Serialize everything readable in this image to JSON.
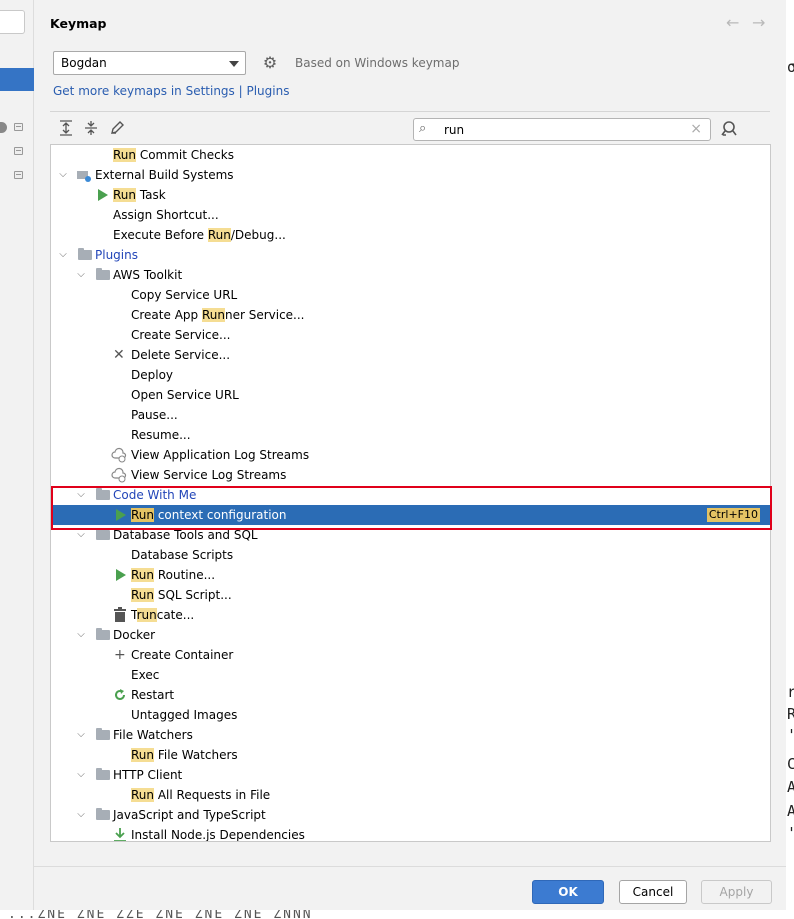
{
  "dialog": {
    "title": "Keymap",
    "nav_back": "←",
    "nav_forward": "→"
  },
  "keymap": {
    "selected": "Bogdan",
    "based_on": "Based on Windows keymap",
    "get_more_link": "Get more keymaps in Settings | Plugins"
  },
  "search": {
    "value": "run",
    "search_icon": "search-with-history-icon",
    "clear_icon": "×"
  },
  "toolbar": {
    "expand_all_icon": "expand-all-icon",
    "collapse_all_icon": "collapse-all-icon",
    "edit_icon": "pencil-icon",
    "find_shortcut_icon": "find-by-shortcut-icon"
  },
  "tree": {
    "rows": [
      {
        "pre": "",
        "hl": "Run",
        "post": " Commit Checks"
      },
      {
        "pre": "External Build Systems",
        "hl": "",
        "post": ""
      },
      {
        "pre": "",
        "hl": "Run",
        "post": " Task"
      },
      {
        "pre": "Assign Shortcut...",
        "hl": "",
        "post": ""
      },
      {
        "pre": "Execute Before ",
        "hl": "Run",
        "post": "/Debug..."
      },
      {
        "pre": "Plugins",
        "hl": "",
        "post": ""
      },
      {
        "pre": "AWS Toolkit",
        "hl": "",
        "post": ""
      },
      {
        "pre": "Copy Service URL",
        "hl": "",
        "post": ""
      },
      {
        "pre": "Create App ",
        "hl": "Run",
        "post": "ner Service..."
      },
      {
        "pre": "Create Service...",
        "hl": "",
        "post": ""
      },
      {
        "pre": "Delete Service...",
        "hl": "",
        "post": ""
      },
      {
        "pre": "Deploy",
        "hl": "",
        "post": ""
      },
      {
        "pre": "Open Service URL",
        "hl": "",
        "post": ""
      },
      {
        "pre": "Pause...",
        "hl": "",
        "post": ""
      },
      {
        "pre": "Resume...",
        "hl": "",
        "post": ""
      },
      {
        "pre": "View Application Log Streams",
        "hl": "",
        "post": ""
      },
      {
        "pre": "View Service Log Streams",
        "hl": "",
        "post": ""
      },
      {
        "pre": "Code With Me",
        "hl": "",
        "post": ""
      },
      {
        "pre": "",
        "hl": "Run",
        "post": " context configuration",
        "shortcut": "Ctrl+F10"
      },
      {
        "pre": "Database Tools and SQL",
        "hl": "",
        "post": ""
      },
      {
        "pre": "Database Scripts",
        "hl": "",
        "post": ""
      },
      {
        "pre": "",
        "hl": "Run",
        "post": " Routine..."
      },
      {
        "pre": "",
        "hl": "Run",
        "post": " SQL Script..."
      },
      {
        "pre": "T",
        "hl": "run",
        "post": "cate..."
      },
      {
        "pre": "Docker",
        "hl": "",
        "post": ""
      },
      {
        "pre": "Create Container",
        "hl": "",
        "post": ""
      },
      {
        "pre": "Exec",
        "hl": "",
        "post": ""
      },
      {
        "pre": "Restart",
        "hl": "",
        "post": ""
      },
      {
        "pre": "Untagged Images",
        "hl": "",
        "post": ""
      },
      {
        "pre": "File Watchers",
        "hl": "",
        "post": ""
      },
      {
        "pre": "",
        "hl": "Run",
        "post": " File Watchers"
      },
      {
        "pre": "HTTP Client",
        "hl": "",
        "post": ""
      },
      {
        "pre": "",
        "hl": "Run",
        "post": " All Requests in File"
      },
      {
        "pre": "JavaScript and TypeScript",
        "hl": "",
        "post": ""
      },
      {
        "pre": "Install Node.js Dependencies",
        "hl": "",
        "post": ""
      }
    ]
  },
  "buttons": {
    "ok": "OK",
    "cancel": "Cancel",
    "apply": "Apply"
  },
  "background": {
    "right_glyphs": [
      "r",
      "R",
      "'",
      "C",
      "A",
      "A",
      "'"
    ],
    "bottom_text": "...ZNE ZNE ZZE ZNE ZNE ZNE ZNNN"
  }
}
